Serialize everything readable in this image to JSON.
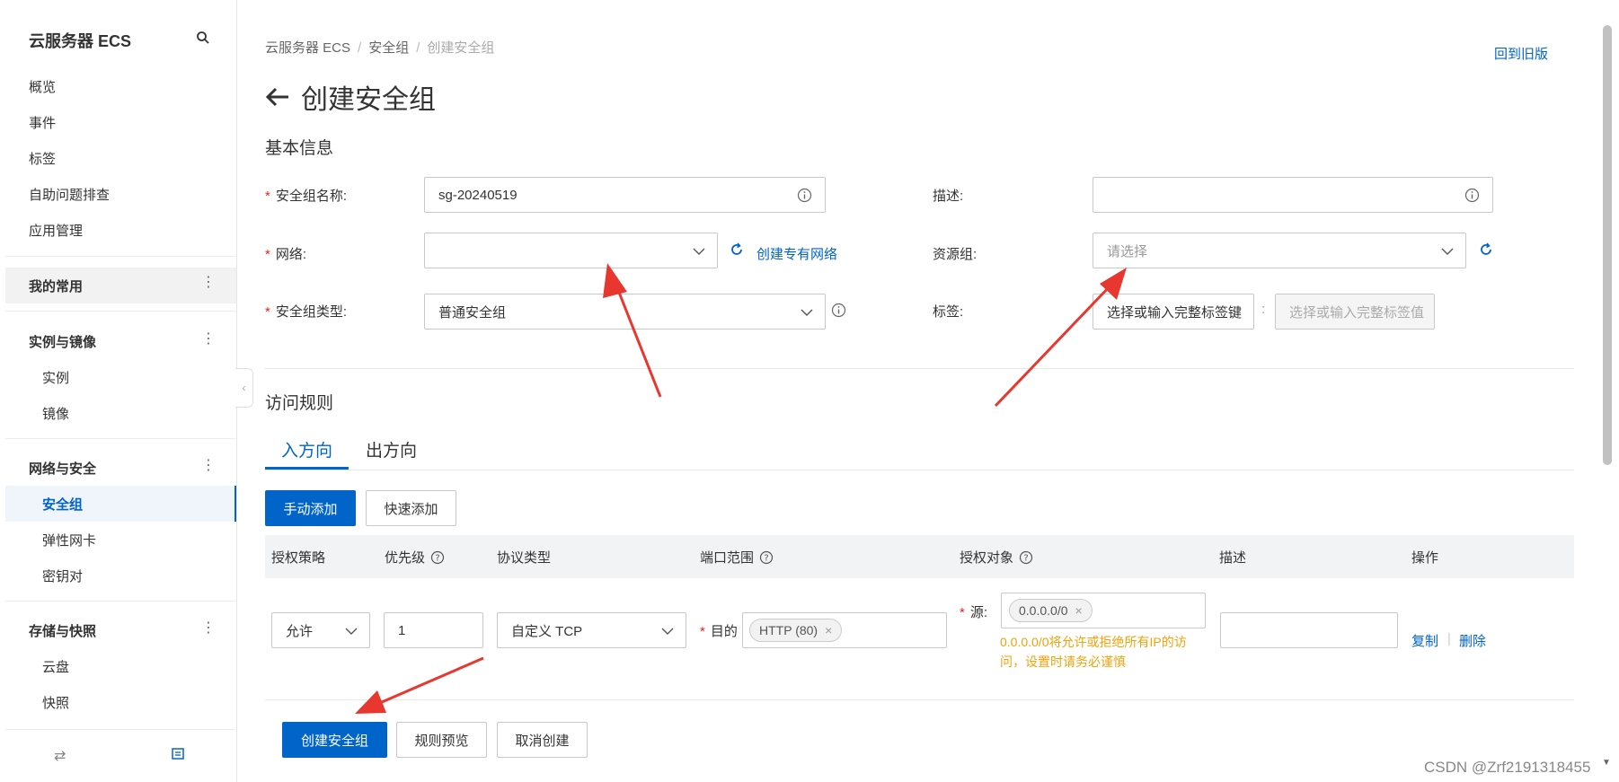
{
  "sidebar": {
    "title": "云服务器 ECS",
    "items": [
      {
        "label": "概览"
      },
      {
        "label": "事件"
      },
      {
        "label": "标签"
      },
      {
        "label": "自助问题排查"
      },
      {
        "label": "应用管理"
      }
    ],
    "favorites_label": "我的常用",
    "groups": [
      {
        "label": "实例与镜像",
        "children": [
          "实例",
          "镜像"
        ]
      },
      {
        "label": "网络与安全",
        "children": [
          "安全组",
          "弹性网卡",
          "密钥对"
        ],
        "active_child": "安全组"
      },
      {
        "label": "存储与快照",
        "children": [
          "云盘",
          "快照"
        ]
      }
    ]
  },
  "breadcrumb": [
    "云服务器 ECS",
    "安全组",
    "创建安全组"
  ],
  "back_old_version": "回到旧版",
  "page_title": "创建安全组",
  "basic_info": {
    "title": "基本信息",
    "sg_name_label": "安全组名称:",
    "sg_name_value": "sg-20240519",
    "network_label": "网络:",
    "network_value": "",
    "create_vpc_link": "创建专有网络",
    "sg_type_label": "安全组类型:",
    "sg_type_value": "普通安全组",
    "description_label": "描述:",
    "description_value": "",
    "resource_group_label": "资源组:",
    "resource_group_placeholder": "请选择",
    "tags_label": "标签:",
    "tag_key_placeholder": "选择或输入完整标签键",
    "tag_value_placeholder": "选择或输入完整标签值",
    "tag_colon": ":"
  },
  "access_rules": {
    "title": "访问规则",
    "tabs": [
      "入方向",
      "出方向"
    ],
    "active_tab": "入方向",
    "manual_add": "手动添加",
    "quick_add": "快速添加",
    "columns": [
      "授权策略",
      "优先级",
      "协议类型",
      "端口范围",
      "授权对象",
      "描述",
      "操作"
    ],
    "row": {
      "policy": "允许",
      "priority": "1",
      "protocol": "自定义 TCP",
      "dest_label": "目的",
      "port_tag": "HTTP (80)",
      "source_label": "源:",
      "source_tag": "0.0.0.0/0",
      "warning": "0.0.0.0/0将允许或拒绝所有IP的访问，设置时请务必谨慎",
      "description": "",
      "copy": "复制",
      "delete": "删除"
    }
  },
  "footer": {
    "create": "创建安全组",
    "preview": "规则预览",
    "cancel": "取消创建"
  },
  "watermark": "CSDN @Zrf2191318455",
  "colors": {
    "primary": "#0064c8",
    "required": "#e0242b",
    "warning": "#f0a20a",
    "annotation_arrow": "#e8372e"
  }
}
